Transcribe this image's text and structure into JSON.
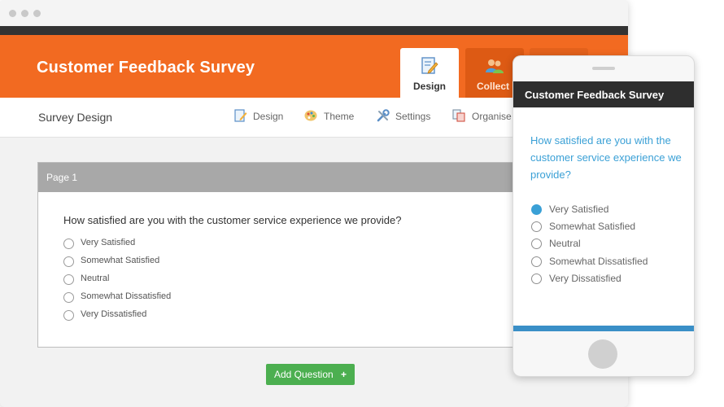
{
  "window": {
    "header_title": "Customer Feedback Survey",
    "tabs": [
      {
        "label": "Design",
        "icon": "pencil-paper-icon",
        "active": true
      },
      {
        "label": "Collect",
        "icon": "users-icon",
        "active": false
      }
    ]
  },
  "subnav": {
    "title": "Survey Design",
    "items": [
      {
        "label": "Design",
        "icon": "pencil-icon"
      },
      {
        "label": "Theme",
        "icon": "palette-icon"
      },
      {
        "label": "Settings",
        "icon": "tools-icon"
      },
      {
        "label": "Organise",
        "icon": "organise-icon"
      }
    ]
  },
  "page": {
    "label": "Page 1",
    "question": "How satisfied are you with the customer service experience we provide?",
    "options": [
      "Very Satisfied",
      "Somewhat Satisfied",
      "Neutral",
      "Somewhat Dissatisfied",
      "Very Dissatisfied"
    ]
  },
  "add_question": {
    "label": "Add Question",
    "icon": "plus-icon"
  },
  "phone": {
    "title": "Customer Feedback Survey",
    "question": "How satisfied are you with the customer service experience we provide?",
    "options": [
      "Very Satisfied",
      "Somewhat Satisfied",
      "Neutral",
      "Somewhat Dissatisfied",
      "Very Dissatisfied"
    ],
    "selected_index": 0
  },
  "colors": {
    "brand_orange": "#f26a21",
    "dark_bar": "#333333",
    "accent_blue": "#3aa0d6",
    "button_green": "#4caf50"
  }
}
